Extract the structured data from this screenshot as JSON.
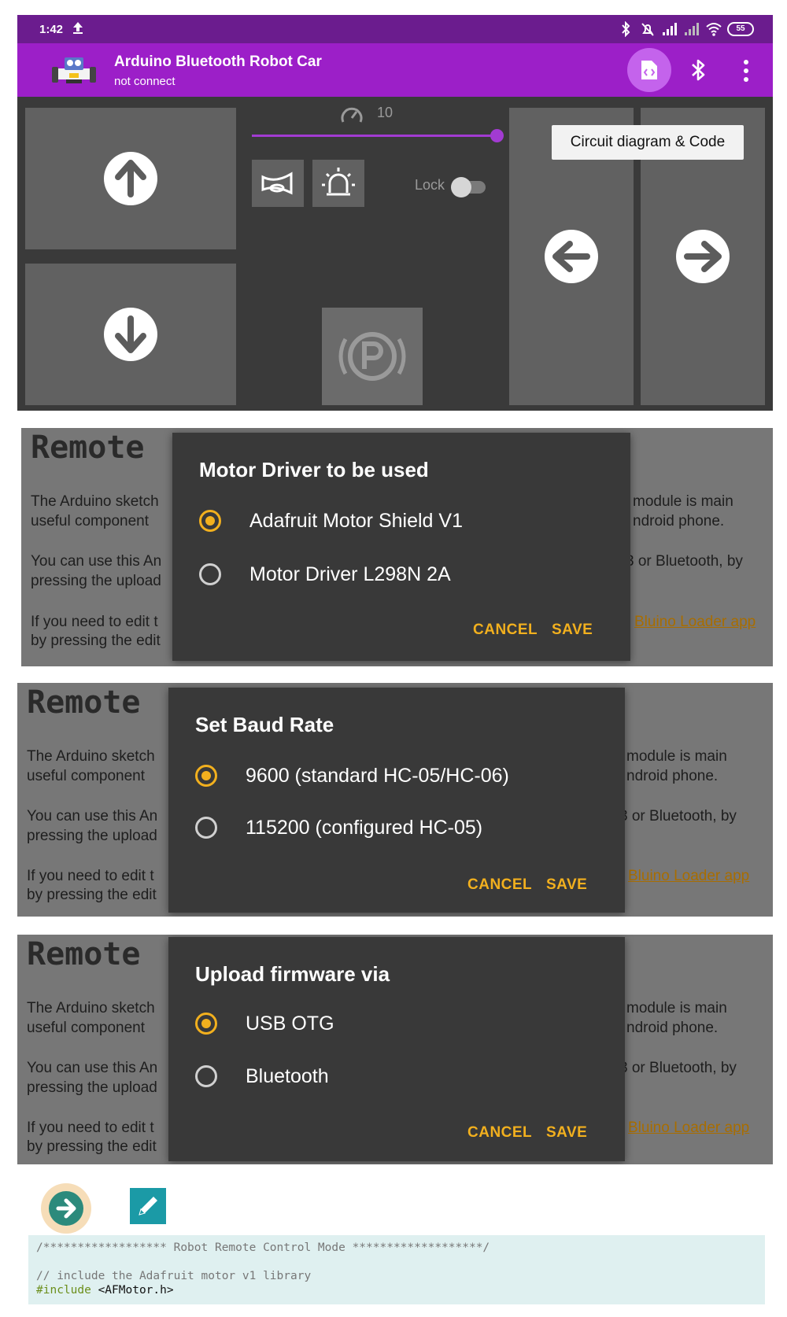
{
  "status_bar": {
    "time": "1:42",
    "battery": "55"
  },
  "app_bar": {
    "title": "Arduino Bluetooth Robot Car",
    "subtitle": "not connect"
  },
  "controls": {
    "speed_value": "10",
    "slider_fraction": 1.0,
    "lock_label": "Lock",
    "lock_on": false,
    "tooltip": "Circuit diagram & Code"
  },
  "background_doc": {
    "heading": "Remote",
    "line1_left": "The Arduino sketch",
    "line1_right": "module is main",
    "line2_left": "useful component",
    "line2_right": "ndroid phone.",
    "line3_left": "You can use this An",
    "line3_right": "3 or Bluetooth, by",
    "line4_left": "pressing the upload",
    "line5_left": "If you need to edit t",
    "line5_link": "Bluino Loader app",
    "line6_left": "by pressing the edit"
  },
  "dialogs": {
    "motor": {
      "title": "Motor Driver to be used",
      "options": [
        "Adafruit Motor Shield V1",
        "Motor Driver L298N 2A"
      ],
      "selected": 0,
      "cancel": "CANCEL",
      "save": "SAVE"
    },
    "baud": {
      "title": "Set Baud Rate",
      "options": [
        "9600 (standard HC-05/HC-06)",
        "115200 (configured HC-05)"
      ],
      "selected": 0,
      "cancel": "CANCEL",
      "save": "SAVE"
    },
    "upload": {
      "title": "Upload firmware via",
      "options": [
        "USB OTG",
        "Bluetooth"
      ],
      "selected": 0,
      "cancel": "CANCEL",
      "save": "SAVE"
    }
  },
  "code": {
    "line1": "/****************** Robot Remote Control Mode *******************/",
    "line2": "// include the Adafruit motor v1 library",
    "line3_keyword": "#include",
    "line3_rest": " <AFMotor.h>"
  },
  "colors": {
    "status_bar": "#6b1c8e",
    "app_bar": "#9c1fc8",
    "accent": "#f2b01e",
    "dialog_bg": "#393939"
  }
}
